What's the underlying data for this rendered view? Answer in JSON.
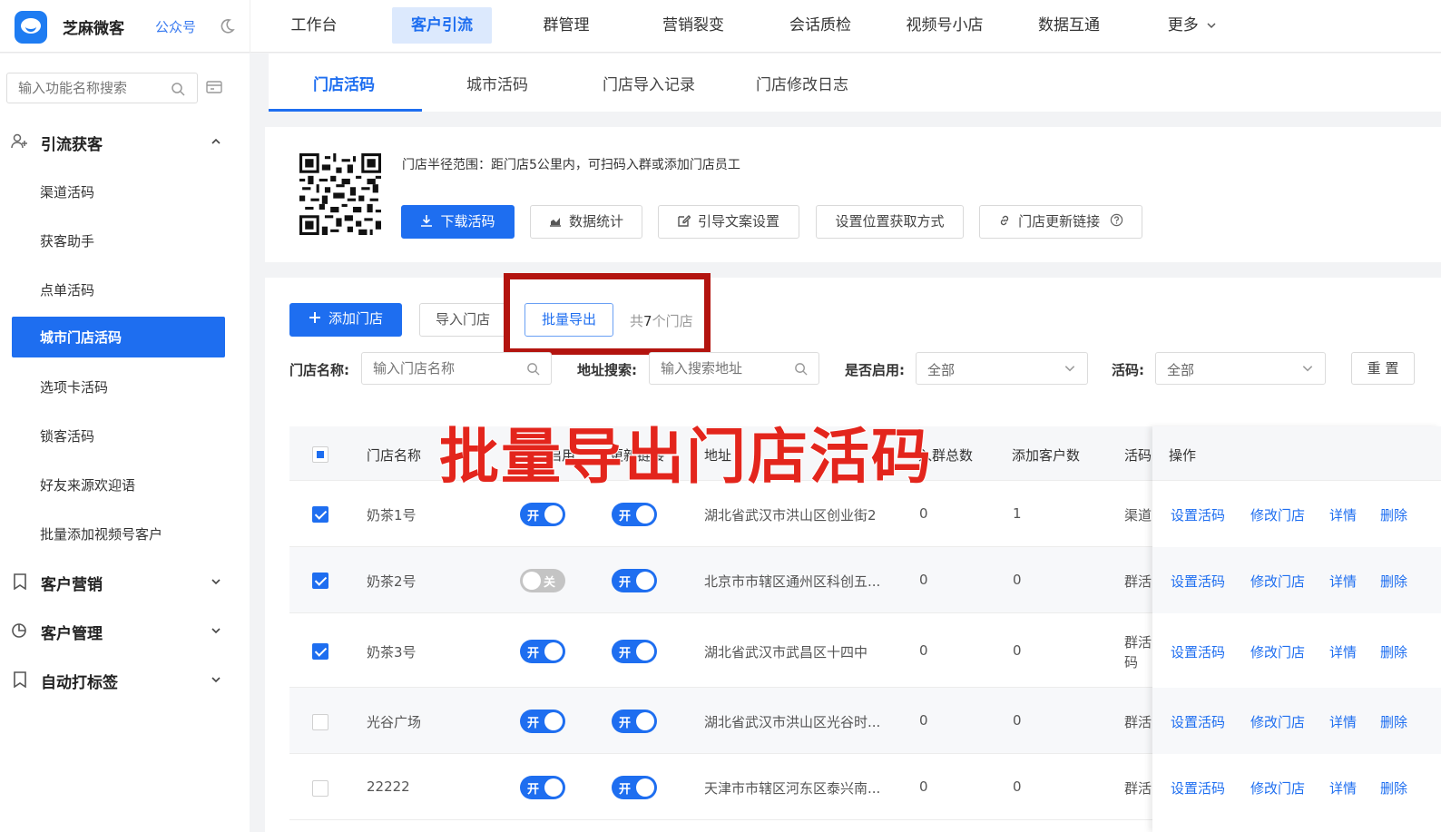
{
  "app": {
    "brand": "芝麻微客",
    "brand_link": "公众号"
  },
  "topnav": [
    "工作台",
    "客户引流",
    "群管理",
    "营销裂变",
    "会话质检",
    "视频号小店",
    "数据互通",
    "更多"
  ],
  "sidebar": {
    "search_placeholder": "输入功能名称搜索",
    "groups": [
      {
        "label": "引流获客"
      },
      {
        "label": "客户营销"
      },
      {
        "label": "客户管理"
      },
      {
        "label": "自动打标签"
      }
    ],
    "items": [
      "渠道活码",
      "获客助手",
      "点单活码",
      "城市门店活码",
      "选项卡活码",
      "锁客活码",
      "好友来源欢迎语",
      "批量添加视频号客户"
    ]
  },
  "tabs": [
    "门店活码",
    "城市活码",
    "门店导入记录",
    "门店修改日志"
  ],
  "qr_card": {
    "radius_text": "门店半径范围：距门店5公里内，可扫码入群或添加门店员工",
    "buttons": [
      "下载活码",
      "数据统计",
      "引导文案设置",
      "设置位置获取方式",
      "门店更新链接"
    ]
  },
  "toolbar": {
    "add": "添加门店",
    "import": "导入门店",
    "export": "批量导出",
    "count_prefix": "共",
    "count_num": "7",
    "count_suffix": "个门店"
  },
  "filters": {
    "name_label": "门店名称:",
    "name_placeholder": "输入门店名称",
    "addr_label": "地址搜索:",
    "addr_placeholder": "输入搜索地址",
    "enabled_label": "是否启用:",
    "enabled_value": "全部",
    "code_label": "活码:",
    "code_value": "全部",
    "reset": "重 置"
  },
  "caption": "批量导出门店活码",
  "table": {
    "headers": [
      "门店名称",
      "是否启用",
      "更新链接",
      "地址",
      "入群总数",
      "添加客户数",
      "活码",
      "操作"
    ],
    "rows": [
      {
        "name": "奶茶1号",
        "enabled": "开",
        "link": "开",
        "address": "湖北省武汉市洪山区创业街2",
        "groups": "0",
        "customers": "1",
        "code": "渠道",
        "checked": true
      },
      {
        "name": "奶茶2号",
        "enabled": "关",
        "link": "开",
        "address": "北京市市辖区通州区科创五...",
        "groups": "0",
        "customers": "0",
        "code": "群活",
        "checked": true
      },
      {
        "name": "奶茶3号",
        "enabled": "开",
        "link": "开",
        "address": "湖北省武汉市武昌区十四中",
        "groups": "0",
        "customers": "0",
        "code": "群活码",
        "checked": true
      },
      {
        "name": "光谷广场",
        "enabled": "开",
        "link": "开",
        "address": "湖北省武汉市洪山区光谷时...",
        "groups": "0",
        "customers": "0",
        "code": "群活",
        "checked": false
      },
      {
        "name": "22222",
        "enabled": "开",
        "link": "开",
        "address": "天津市市辖区河东区泰兴南...",
        "groups": "0",
        "customers": "0",
        "code": "群活",
        "checked": false
      }
    ],
    "ops": [
      "设置活码",
      "修改门店",
      "详情",
      "删除"
    ]
  },
  "colors": {
    "primary": "#1e6ef0",
    "highlight": "#b3140f",
    "caption": "#e3251c"
  }
}
